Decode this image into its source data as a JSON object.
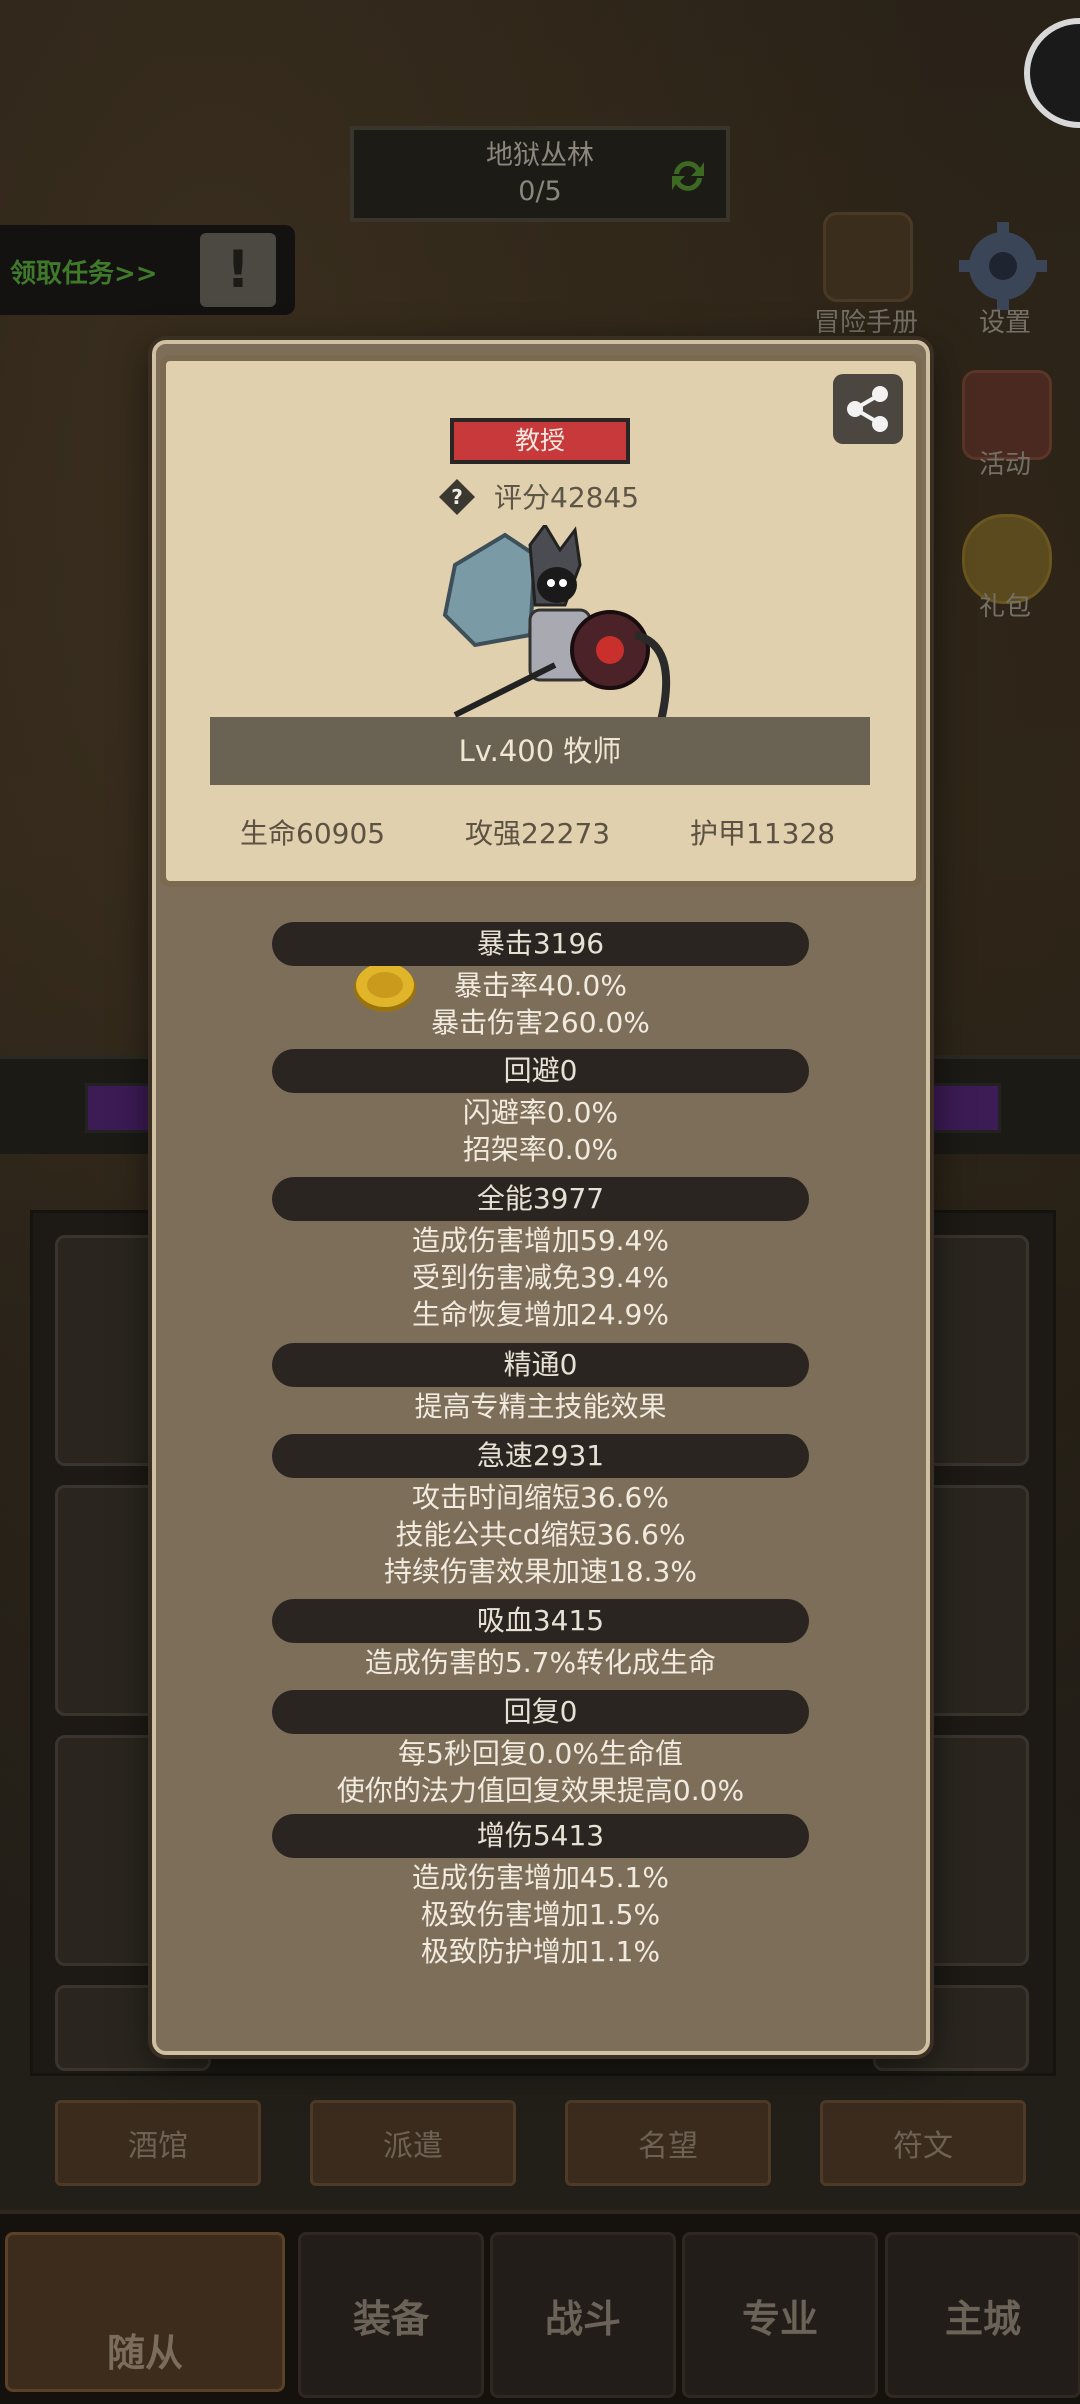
{
  "background": {
    "quest": {
      "name": "地狱丛林",
      "progress": "0/5"
    },
    "task_link": "领取任务>>",
    "side_menu": [
      "冒险手册",
      "设置",
      "活动",
      "礼包"
    ],
    "sub_buttons": [
      "酒馆",
      "派遣",
      "名望",
      "符文"
    ],
    "nav": [
      "随从",
      "装备",
      "战斗",
      "专业",
      "主城"
    ]
  },
  "hero": {
    "title": "教授",
    "score": "评分42845",
    "level_class": "Lv.400 牧师",
    "stats": [
      "生命60905",
      "攻强22273",
      "护甲11328"
    ]
  },
  "sections": [
    {
      "header": "暴击3196",
      "lines": [
        "暴击率40.0%",
        "暴击伤害260.0%"
      ]
    },
    {
      "header": "回避0",
      "lines": [
        "闪避率0.0%",
        "招架率0.0%"
      ]
    },
    {
      "header": "全能3977",
      "lines": [
        "造成伤害增加59.4%",
        "受到伤害减免39.4%",
        "生命恢复增加24.9%"
      ]
    },
    {
      "header": "精通0",
      "lines": [
        "提高专精主技能效果"
      ]
    },
    {
      "header": "急速2931",
      "lines": [
        "攻击时间缩短36.6%",
        "技能公共cd缩短36.6%",
        "持续伤害效果加速18.3%"
      ]
    },
    {
      "header": "吸血3415",
      "lines": [
        "造成伤害的5.7%转化成生命"
      ]
    },
    {
      "header": "回复0",
      "lines": [
        "每5秒回复0.0%生命值",
        "使你的法力值回复效果提高0.0%"
      ]
    },
    {
      "header": "增伤5413",
      "lines": [
        "造成伤害增加45.1%",
        "极致伤害增加1.5%",
        "极致防护增加1.1%"
      ]
    }
  ]
}
